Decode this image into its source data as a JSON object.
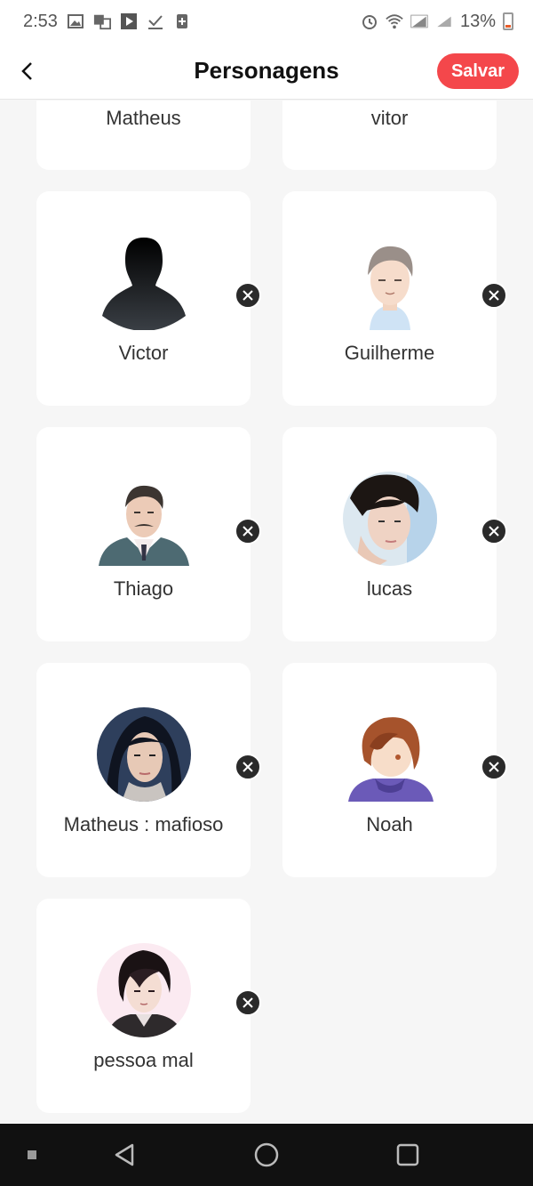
{
  "status_bar": {
    "time": "2:53",
    "battery_percent": "13%",
    "icons_left": [
      "image-icon",
      "translate-icon",
      "play-icon",
      "check-icon",
      "sim-icon"
    ],
    "icons_right": [
      "alarm-icon",
      "wifi-icon",
      "signal-icon",
      "signal-icon-2",
      "battery-icon"
    ]
  },
  "header": {
    "title": "Personagens",
    "save_label": "Salvar",
    "accent_color": "#f4474b"
  },
  "characters": [
    {
      "name": "Matheus",
      "partial": true
    },
    {
      "name": "vitor",
      "partial": true
    },
    {
      "name": "Victor",
      "avatar": "silhouette"
    },
    {
      "name": "Guilherme",
      "avatar": "anime-man-gray-hair"
    },
    {
      "name": "Thiago",
      "avatar": "anime-man-mustache-suit"
    },
    {
      "name": "lucas",
      "avatar": "photo-man-dark-hair"
    },
    {
      "name": "Matheus : mafioso",
      "avatar": "photo-man-long-hair"
    },
    {
      "name": "Noah",
      "avatar": "anime-boy-brown-hair"
    },
    {
      "name": "pessoa mal",
      "avatar": "anime-man-black-hair"
    }
  ],
  "nav_bar": [
    "recent-square",
    "back-triangle",
    "home-circle",
    "overview-square"
  ]
}
